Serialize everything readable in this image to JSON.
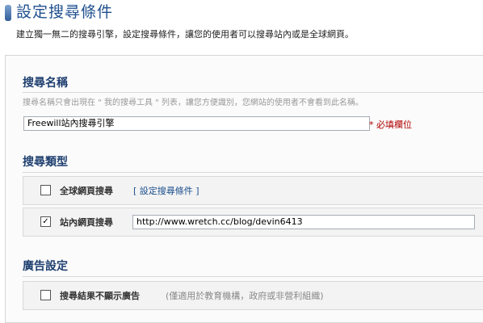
{
  "header": {
    "title": "設定搜尋條件",
    "description": "建立獨一無二的搜尋引擎，設定搜尋條件，讓您的使用者可以搜尋站內或是全球網頁。"
  },
  "search_name": {
    "heading": "搜尋名稱",
    "hint": "搜尋名稱只會出現在 \" 我的搜尋工具 \" 列表，讓您方便識別，您網站的使用者不會看到此名稱。",
    "value": "Freewill站內搜尋引擎",
    "required_label": "* 必填欄位"
  },
  "search_type": {
    "heading": "搜尋類型",
    "global_option": {
      "checked": false,
      "label": "全球網頁搜尋",
      "link": "[ 設定搜尋條件 ]"
    },
    "site_option": {
      "checked": true,
      "label": "站內網頁搜尋",
      "url": "http://www.wretch.cc/blog/devin6413"
    }
  },
  "ad_settings": {
    "heading": "廣告設定",
    "option": {
      "checked": false,
      "label": "搜尋結果不顯示廣告",
      "note": "(僅適用於教育機構，政府或非營利組織)"
    }
  }
}
